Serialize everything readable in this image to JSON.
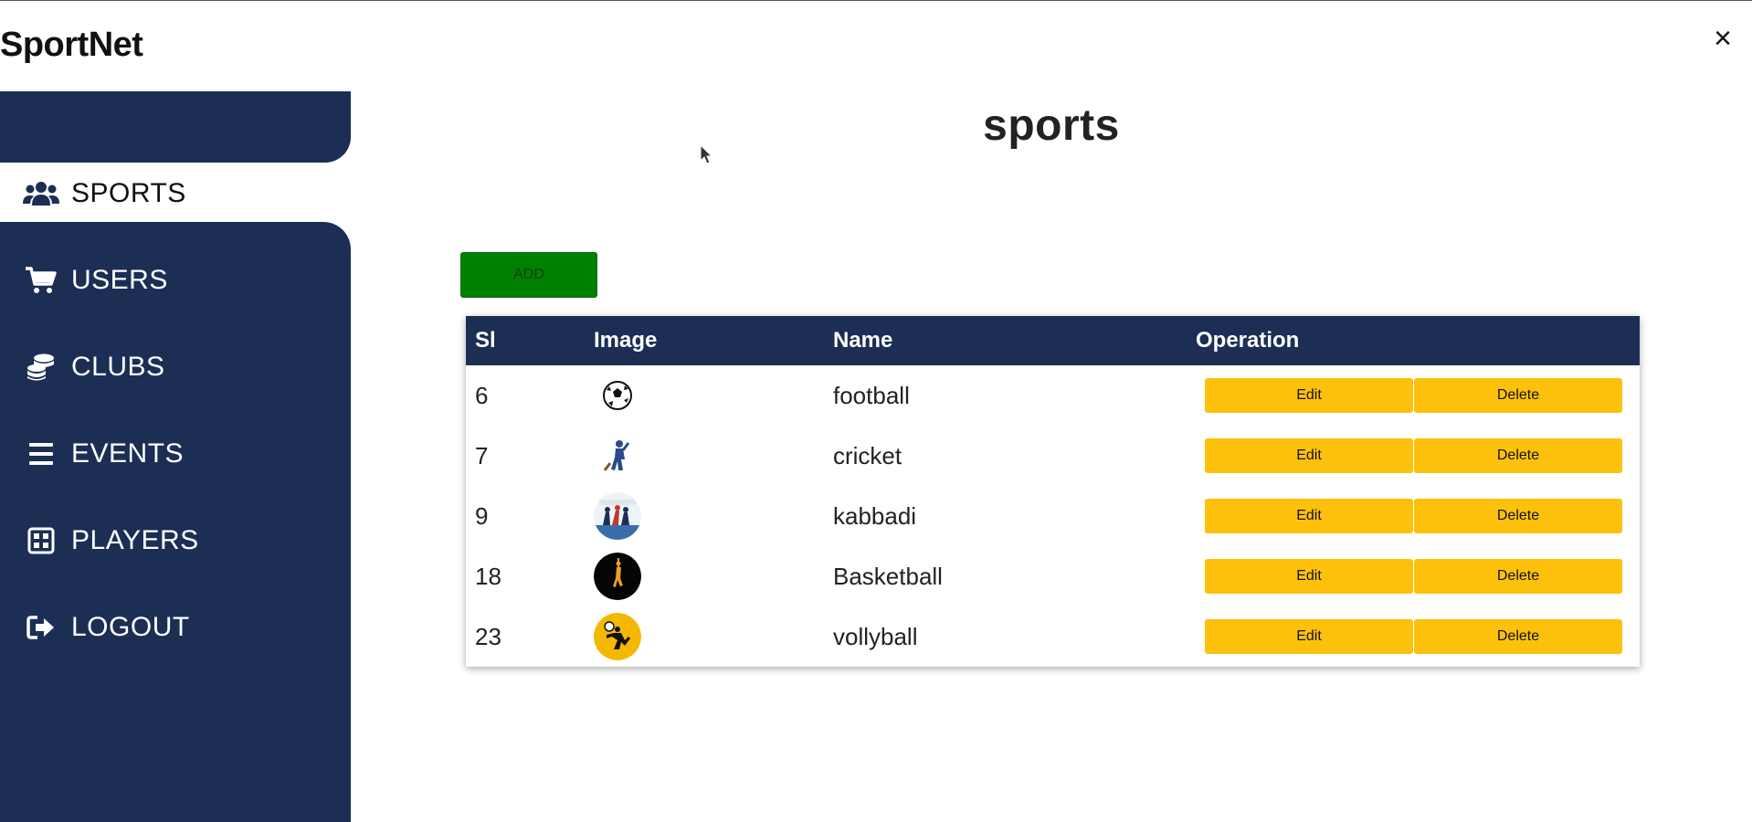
{
  "app": {
    "brand": "SportNet",
    "close_symbol": "×"
  },
  "sidebar": {
    "items": [
      {
        "label": "SPORTS",
        "icon": "users-icon",
        "active": true
      },
      {
        "label": "USERS",
        "icon": "cart-icon",
        "active": false
      },
      {
        "label": "CLUBS",
        "icon": "coins-icon",
        "active": false
      },
      {
        "label": "EVENTS",
        "icon": "list-icon",
        "active": false
      },
      {
        "label": "PLAYERS",
        "icon": "grid-icon",
        "active": false
      },
      {
        "label": "LOGOUT",
        "icon": "logout-icon",
        "active": false
      }
    ],
    "bg_color": "#1c2e54"
  },
  "main": {
    "title": "sports",
    "add_label": "ADD",
    "add_color": "#008000",
    "button_color": "#fdc10c",
    "table": {
      "headers": [
        "Sl",
        "Image",
        "Name",
        "Operation"
      ],
      "rows": [
        {
          "sl": "6",
          "image": "football-image",
          "name": "football",
          "edit": "Edit",
          "delete": "Delete"
        },
        {
          "sl": "7",
          "image": "cricket-image",
          "name": "cricket",
          "edit": "Edit",
          "delete": "Delete"
        },
        {
          "sl": "9",
          "image": "kabbadi-image",
          "name": "kabbadi",
          "edit": "Edit",
          "delete": "Delete"
        },
        {
          "sl": "18",
          "image": "basketball-image",
          "name": "Basketball",
          "edit": "Edit",
          "delete": "Delete"
        },
        {
          "sl": "23",
          "image": "vollyball-image",
          "name": "vollyball",
          "edit": "Edit",
          "delete": "Delete"
        }
      ]
    }
  }
}
